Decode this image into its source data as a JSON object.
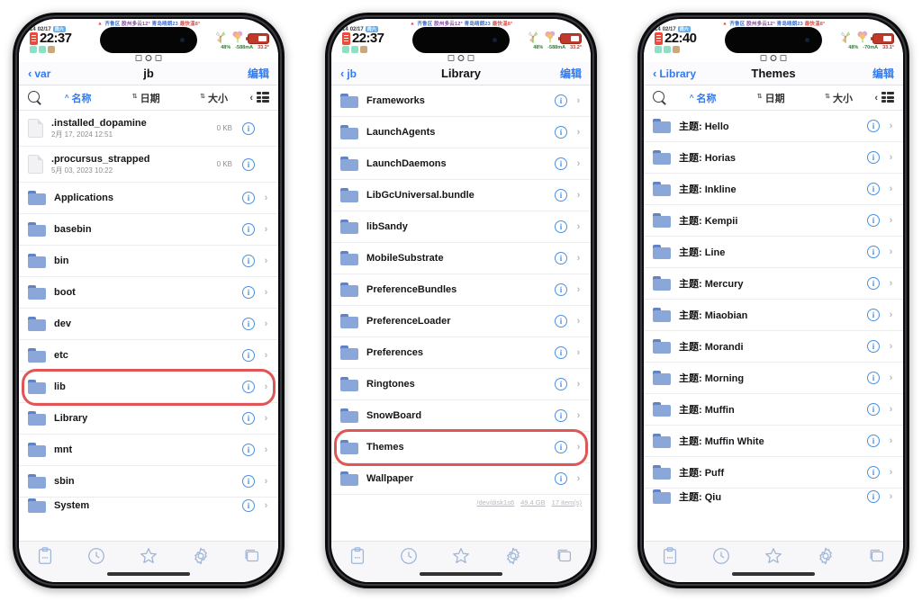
{
  "marquee": {
    "text_parts": [
      "齐鲁区",
      "胶州多云12°",
      "青岛晴朗23",
      "最快温8°"
    ],
    "prefix_icon": "alert-icon"
  },
  "phones": [
    {
      "id": "phone-1",
      "status": {
        "date": "02/17",
        "weekday": "14",
        "badge": "周六",
        "time": "22:37",
        "battery_pct": "48%",
        "current": "-588mA",
        "temp": "33.2°"
      },
      "nav": {
        "back": "var",
        "title": "jb",
        "edit": "编辑"
      },
      "sort": {
        "name": "名称",
        "date": "日期",
        "size": "大小",
        "active": "name"
      },
      "highlight_row_index": 8,
      "footer": null,
      "rows": [
        {
          "type": "file",
          "name": ".installed_dopamine",
          "sub": "2月 17, 2024 12:51",
          "size": "0 KB",
          "disclosure": false
        },
        {
          "type": "file",
          "name": ".procursus_strapped",
          "sub": "5月 03, 2023 10:22",
          "size": "0 KB",
          "disclosure": false
        },
        {
          "type": "folder",
          "name": "Applications",
          "sub": "",
          "size": "",
          "disclosure": true
        },
        {
          "type": "folder",
          "name": "basebin",
          "sub": "",
          "size": "",
          "disclosure": true
        },
        {
          "type": "folder",
          "name": "bin",
          "sub": "",
          "size": "",
          "disclosure": true
        },
        {
          "type": "folder",
          "name": "boot",
          "sub": "",
          "size": "",
          "disclosure": true
        },
        {
          "type": "folder",
          "name": "dev",
          "sub": "",
          "size": "",
          "disclosure": true
        },
        {
          "type": "folder",
          "name": "etc",
          "sub": "",
          "size": "",
          "disclosure": true
        },
        {
          "type": "folder",
          "name": "lib",
          "sub": "",
          "size": "",
          "disclosure": true
        },
        {
          "type": "folder",
          "name": "Library",
          "sub": "",
          "size": "",
          "disclosure": true
        },
        {
          "type": "folder",
          "name": "mnt",
          "sub": "",
          "size": "",
          "disclosure": true
        },
        {
          "type": "folder",
          "name": "sbin",
          "sub": "",
          "size": "",
          "disclosure": true
        },
        {
          "type": "folder",
          "name": "System",
          "sub": "",
          "size": "",
          "disclosure": true,
          "partial": true
        }
      ]
    },
    {
      "id": "phone-2",
      "status": {
        "date": "02/17",
        "weekday": "14",
        "badge": "周六",
        "time": "22:37",
        "battery_pct": "48%",
        "current": "-588mA",
        "temp": "33.2°"
      },
      "nav": {
        "back": "jb",
        "title": "Library",
        "edit": "编辑"
      },
      "sort": null,
      "highlight_row_index": 11,
      "footer": {
        "device": "/dev/disk1s6",
        "capacity": "49.4 GB",
        "count": "17 item(s)"
      },
      "rows": [
        {
          "type": "folder",
          "name": "Frameworks",
          "sub": "",
          "size": "",
          "disclosure": true,
          "partial_top": true
        },
        {
          "type": "folder",
          "name": "LaunchAgents",
          "sub": "",
          "size": "",
          "disclosure": true
        },
        {
          "type": "folder",
          "name": "LaunchDaemons",
          "sub": "",
          "size": "",
          "disclosure": true
        },
        {
          "type": "folder",
          "name": "LibGcUniversal.bundle",
          "sub": "",
          "size": "",
          "disclosure": true
        },
        {
          "type": "folder",
          "name": "libSandy",
          "sub": "",
          "size": "",
          "disclosure": true
        },
        {
          "type": "folder",
          "name": "MobileSubstrate",
          "sub": "",
          "size": "",
          "disclosure": true
        },
        {
          "type": "folder",
          "name": "PreferenceBundles",
          "sub": "",
          "size": "",
          "disclosure": true
        },
        {
          "type": "folder",
          "name": "PreferenceLoader",
          "sub": "",
          "size": "",
          "disclosure": true
        },
        {
          "type": "folder",
          "name": "Preferences",
          "sub": "",
          "size": "",
          "disclosure": true
        },
        {
          "type": "folder",
          "name": "Ringtones",
          "sub": "",
          "size": "",
          "disclosure": true
        },
        {
          "type": "folder",
          "name": "SnowBoard",
          "sub": "",
          "size": "",
          "disclosure": true
        },
        {
          "type": "folder",
          "name": "Themes",
          "sub": "",
          "size": "",
          "disclosure": true
        },
        {
          "type": "folder",
          "name": "Wallpaper",
          "sub": "",
          "size": "",
          "disclosure": true
        }
      ]
    },
    {
      "id": "phone-3",
      "status": {
        "date": "02/17",
        "weekday": "14",
        "badge": "周六",
        "time": "22:40",
        "battery_pct": "48%",
        "current": "-70mA",
        "temp": "33.1°"
      },
      "nav": {
        "back": "Library",
        "title": "Themes",
        "edit": "编辑"
      },
      "sort": {
        "name": "名称",
        "date": "日期",
        "size": "大小",
        "active": "name"
      },
      "highlight_row_index": -1,
      "footer": null,
      "rows": [
        {
          "type": "folder",
          "name": "主题: Hello",
          "sub": "",
          "size": "",
          "disclosure": true
        },
        {
          "type": "folder",
          "name": "主题: Horias",
          "sub": "",
          "size": "",
          "disclosure": true
        },
        {
          "type": "folder",
          "name": "主题: Inkline",
          "sub": "",
          "size": "",
          "disclosure": true
        },
        {
          "type": "folder",
          "name": "主题: Kempii",
          "sub": "",
          "size": "",
          "disclosure": true
        },
        {
          "type": "folder",
          "name": "主题: Line",
          "sub": "",
          "size": "",
          "disclosure": true
        },
        {
          "type": "folder",
          "name": "主题: Mercury",
          "sub": "",
          "size": "",
          "disclosure": true
        },
        {
          "type": "folder",
          "name": "主题: Miaobian",
          "sub": "",
          "size": "",
          "disclosure": true
        },
        {
          "type": "folder",
          "name": "主题: Morandi",
          "sub": "",
          "size": "",
          "disclosure": true
        },
        {
          "type": "folder",
          "name": "主题: Morning",
          "sub": "",
          "size": "",
          "disclosure": true
        },
        {
          "type": "folder",
          "name": "主题: Muffin",
          "sub": "",
          "size": "",
          "disclosure": true
        },
        {
          "type": "folder",
          "name": "主题: Muffin White",
          "sub": "",
          "size": "",
          "disclosure": true
        },
        {
          "type": "folder",
          "name": "主题: Puff",
          "sub": "",
          "size": "",
          "disclosure": true
        },
        {
          "type": "folder",
          "name": "主题: Qiu",
          "sub": "",
          "size": "",
          "disclosure": true,
          "partial": true
        }
      ]
    }
  ],
  "tabbar": {
    "items": [
      {
        "icon": "clipboard-icon",
        "label": ""
      },
      {
        "icon": "clock-icon",
        "label": ""
      },
      {
        "icon": "star-icon",
        "label": ""
      },
      {
        "icon": "gear-icon",
        "label": ""
      },
      {
        "icon": "windows-icon",
        "label": ""
      }
    ]
  },
  "colors": {
    "accent": "#2f7bf6",
    "folder": "#8ba7da",
    "highlight": "#e05656",
    "tab_icon": "#9fb6d8"
  }
}
